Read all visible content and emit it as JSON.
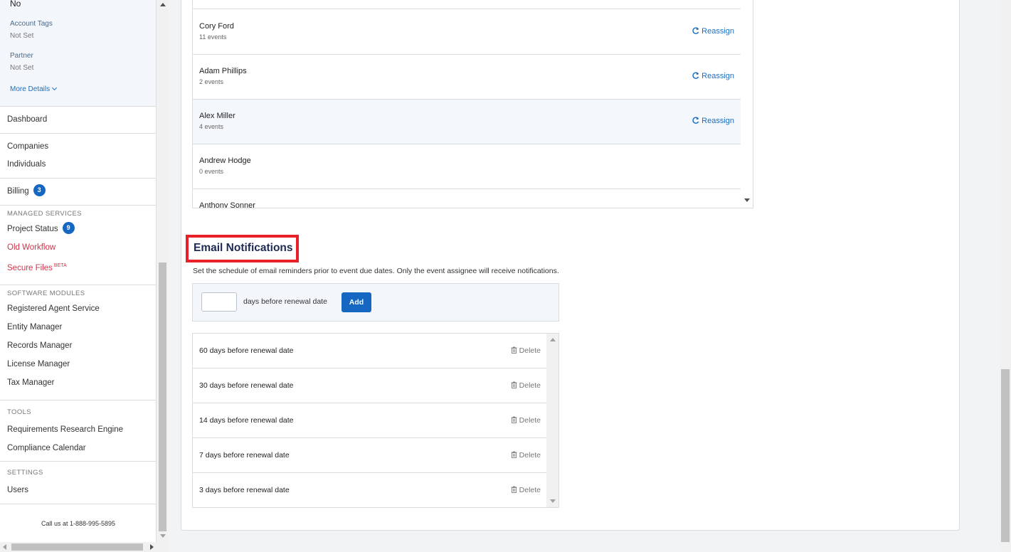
{
  "sidebar": {
    "info": {
      "top_value": "No",
      "account_tags_label": "Account Tags",
      "account_tags_value": "Not Set",
      "partner_label": "Partner",
      "partner_value": "Not Set",
      "more_details": "More Details"
    },
    "dashboard": "Dashboard",
    "companies": "Companies",
    "individuals": "Individuals",
    "billing": "Billing",
    "billing_badge": "3",
    "managed_services_heading": "MANAGED SERVICES",
    "project_status": "Project Status",
    "project_status_badge": "9",
    "old_workflow": "Old Workflow",
    "secure_files": "Secure Files",
    "secure_files_tag": "BETA",
    "software_modules_heading": "SOFTWARE MODULES",
    "registered_agent_service": "Registered Agent Service",
    "entity_manager": "Entity Manager",
    "records_manager": "Records Manager",
    "license_manager": "License Manager",
    "tax_manager": "Tax Manager",
    "tools_heading": "TOOLS",
    "requirements_research_engine": "Requirements Research Engine",
    "compliance_calendar": "Compliance Calendar",
    "settings_heading": "SETTINGS",
    "users": "Users",
    "call_us": "Call us at 1-888-995-5895"
  },
  "assignees": {
    "reassign_label": "Reassign",
    "rows": [
      {
        "name": "Cory Ford",
        "events": "11 events"
      },
      {
        "name": "Adam Phillips",
        "events": "2 events"
      },
      {
        "name": "Alex Miller",
        "events": "4 events"
      },
      {
        "name": "Andrew Hodge",
        "events": "0 events"
      },
      {
        "name": "Anthony Sonner",
        "events": ""
      }
    ]
  },
  "email_notifications": {
    "title": "Email Notifications",
    "description": "Set the schedule of email reminders prior to event due dates. Only the event assignee will receive notifications.",
    "input_value": "",
    "days_label": "days before renewal date",
    "add_button": "Add",
    "delete_label": "Delete",
    "reminders": [
      "60 days before renewal date",
      "30 days before renewal date",
      "14 days before renewal date",
      "7 days before renewal date",
      "3 days before renewal date"
    ]
  },
  "colors": {
    "accent": "#1667c1",
    "link": "#1a6ec0",
    "highlight_border": "#e8202a",
    "danger_text": "#d0344b"
  },
  "icons": {
    "reassign": "refresh-icon",
    "delete": "trash-icon",
    "more_details": "chevron-down-icon"
  }
}
